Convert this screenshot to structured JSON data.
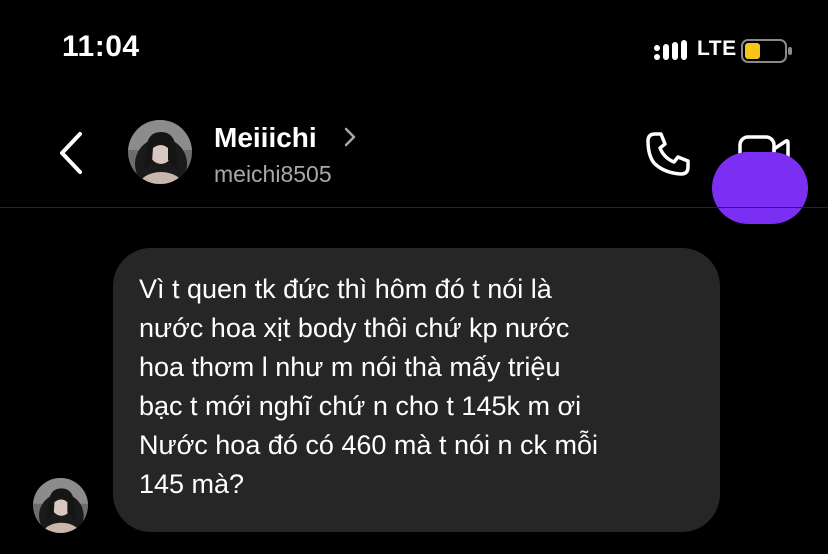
{
  "status_bar": {
    "time": "11:04",
    "network": "LTE",
    "battery_color": "#f5c518"
  },
  "header": {
    "contact_name": "Meiiichi",
    "username": "meichi8505"
  },
  "messages": [
    {
      "direction": "incoming",
      "text": "Vì t quen tk đức thì hôm đó t nói là\nnước hoa xịt body thôi chứ kp nước\nhoa thơm l như m nói thà mấy triệu\nbạc t mới nghĩ chứ n cho t 145k m ơi\nNước hoa đó có 460 mà t nói n ck mỗi\n145 mà?"
    }
  ],
  "colors": {
    "background": "#000000",
    "incoming_bubble": "#262626",
    "outgoing_bubble": "#7b2ff2",
    "secondary_text": "#a8a8a8"
  }
}
